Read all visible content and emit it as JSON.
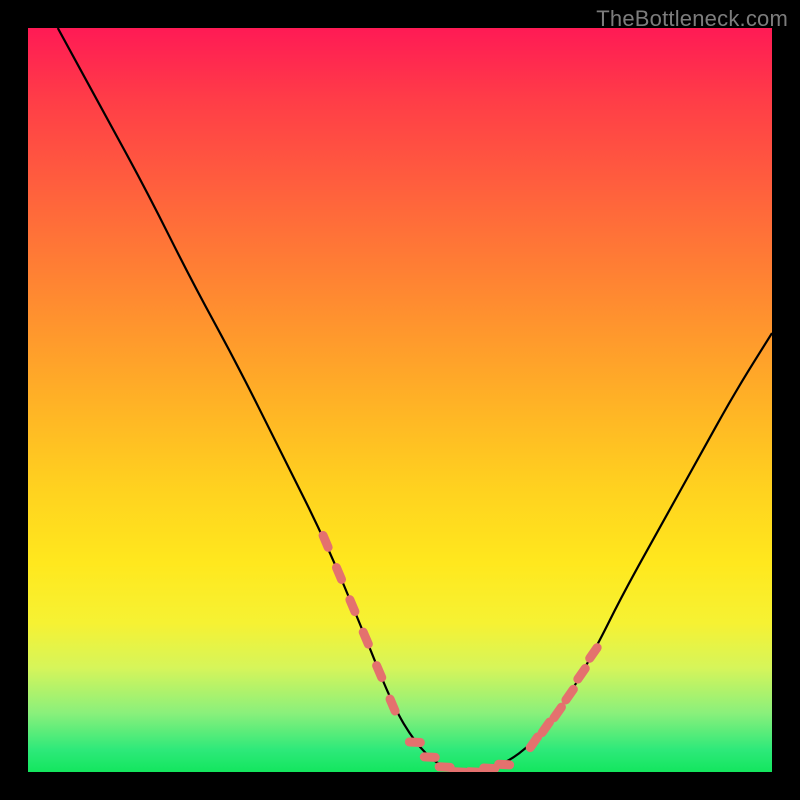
{
  "watermark": "TheBottleneck.com",
  "chart_data": {
    "type": "line",
    "title": "",
    "xlabel": "",
    "ylabel": "",
    "xlim": [
      0,
      100
    ],
    "ylim": [
      0,
      100
    ],
    "grid": false,
    "legend": false,
    "series": [
      {
        "name": "curve",
        "color": "#000000",
        "x": [
          4,
          10,
          16,
          22,
          28,
          34,
          40,
          45,
          49,
          52,
          55,
          58,
          60,
          64,
          68,
          72,
          76,
          80,
          85,
          90,
          95,
          100
        ],
        "y": [
          100,
          89,
          78,
          66,
          55,
          43,
          31,
          19,
          9,
          4,
          1,
          0,
          0,
          1,
          4,
          9,
          16,
          24,
          33,
          42,
          51,
          59
        ]
      }
    ],
    "highlight_segments": {
      "color": "#e4716e",
      "left_x_range": [
        40,
        49
      ],
      "bottom_x_range": [
        52,
        64
      ],
      "right_x_range": [
        68,
        76
      ]
    },
    "background_gradient": {
      "top": "#ff1a55",
      "bottom": "#13e65e"
    }
  }
}
